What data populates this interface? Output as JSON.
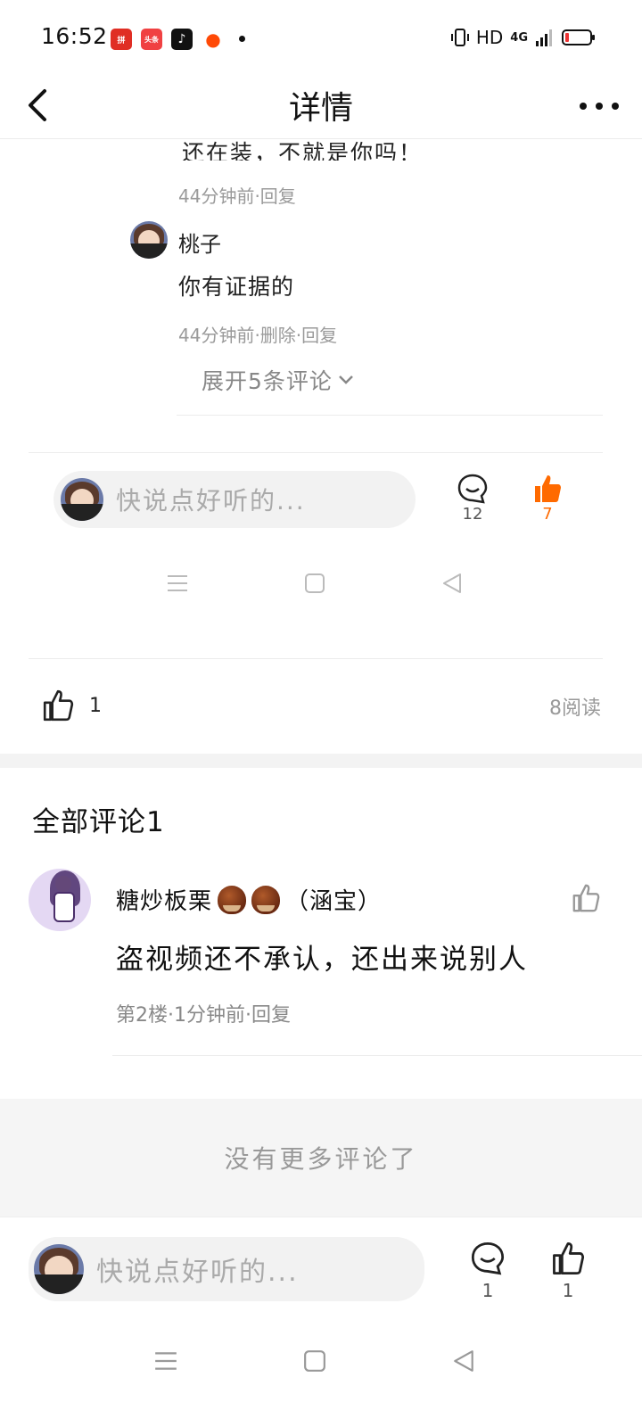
{
  "status_bar": {
    "time": "16:52",
    "apps": [
      {
        "icon": "pinduoduo-icon",
        "label": "拼",
        "color": "#e02e24"
      },
      {
        "icon": "toutiao-icon",
        "label": "头条",
        "color": "#f04142"
      },
      {
        "icon": "douyin-icon",
        "label": "♪",
        "color": "#111111"
      },
      {
        "icon": "kuaishou-icon",
        "label": "●",
        "color": "#ff4906"
      }
    ],
    "network": "HD",
    "signal_label": "4G"
  },
  "header": {
    "title": "详情"
  },
  "embedded": {
    "clipped_text": "还在装，不就是你吗！",
    "first_meta": "44分钟前·回复",
    "reply": {
      "name": "桃子",
      "text": "你有证据的",
      "meta": "44分钟前·删除·回复"
    },
    "expand_label": "展开5条评论",
    "input_placeholder": "快说点好听的...",
    "comment_count": "12",
    "like_count": "7"
  },
  "post": {
    "like_count": "1",
    "read_count": "8阅读"
  },
  "comments": {
    "title": "全部评论1",
    "items": [
      {
        "author": "糖炒板栗",
        "author_suffix": "（涵宝）",
        "text": "盗视频还不承认，还出来说别人",
        "meta": "第2楼·1分钟前·回复"
      }
    ],
    "no_more": "没有更多评论了"
  },
  "bottom_bar": {
    "input_placeholder": "快说点好听的...",
    "comment_count": "1",
    "like_count": "1"
  },
  "colors": {
    "accent": "#ff6a00",
    "muted": "#999999"
  }
}
